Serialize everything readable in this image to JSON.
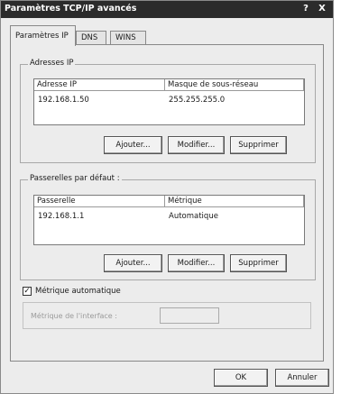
{
  "window": {
    "title": "Paramètres TCP/IP avancés",
    "help_label": "?",
    "close_label": "X"
  },
  "tabs": [
    {
      "label": "Paramètres IP",
      "active": true
    },
    {
      "label": "DNS",
      "active": false
    },
    {
      "label": "WINS",
      "active": false
    }
  ],
  "ip_addresses": {
    "title": "Adresses IP",
    "columns": [
      "Adresse IP",
      "Masque de sous-réseau"
    ],
    "rows": [
      [
        "192.168.1.50",
        "255.255.255.0"
      ]
    ],
    "buttons": {
      "add": "Ajouter...",
      "edit": "Modifier...",
      "remove": "Supprimer"
    }
  },
  "gateways": {
    "title": "Passerelles par défaut :",
    "columns": [
      "Passerelle",
      "Métrique"
    ],
    "rows": [
      [
        "192.168.1.1",
        "Automatique"
      ]
    ],
    "buttons": {
      "add": "Ajouter...",
      "edit": "Modifier...",
      "remove": "Supprimer"
    }
  },
  "auto_metric": {
    "label": "Métrique automatique",
    "checked": true,
    "check_glyph": "✓"
  },
  "interface_metric": {
    "label": "Métrique de l'interface :",
    "value": ""
  },
  "footer": {
    "ok": "OK",
    "cancel": "Annuler"
  }
}
